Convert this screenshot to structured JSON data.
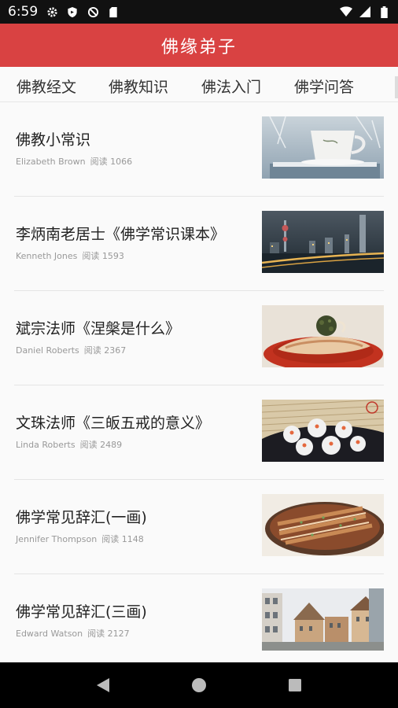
{
  "status_bar": {
    "time": "6:59",
    "icons_left": [
      "gear-icon",
      "shield-icon",
      "no-sync-icon",
      "sd-card-icon"
    ],
    "icons_right": [
      "wifi-icon",
      "signal-icon",
      "battery-icon"
    ]
  },
  "app_bar": {
    "title": "佛缘弟子",
    "background_color": "#d94242"
  },
  "tabs": [
    {
      "label": "佛教经文"
    },
    {
      "label": "佛教知识"
    },
    {
      "label": "佛法入门"
    },
    {
      "label": "佛学问答"
    }
  ],
  "articles": [
    {
      "title": "佛教小常识",
      "author": "Elizabeth Brown",
      "reads": "阅读 1066",
      "thumbnail": "teacup-in-snow"
    },
    {
      "title": "李炳南老居士《佛学常识课本》",
      "author": "Kenneth Jones",
      "reads": "阅读 1593",
      "thumbnail": "city-skyline"
    },
    {
      "title": "斌宗法师《涅槃是什么》",
      "author": "Daniel Roberts",
      "reads": "阅读 2367",
      "thumbnail": "plated-dish"
    },
    {
      "title": "文珠法师《三皈五戒的意义》",
      "author": "Linda Roberts",
      "reads": "阅读 2489",
      "thumbnail": "dumplings"
    },
    {
      "title": "佛学常见辞汇(一画)",
      "author": "Jennifer Thompson",
      "reads": "阅读 1148",
      "thumbnail": "rolled-dish"
    },
    {
      "title": "佛学常见辞汇(三画)",
      "author": "Edward Watson",
      "reads": "阅读 2127",
      "thumbnail": "old-town-street"
    }
  ],
  "nav_bar": {
    "buttons": [
      "back-icon",
      "home-icon",
      "recents-icon"
    ]
  }
}
